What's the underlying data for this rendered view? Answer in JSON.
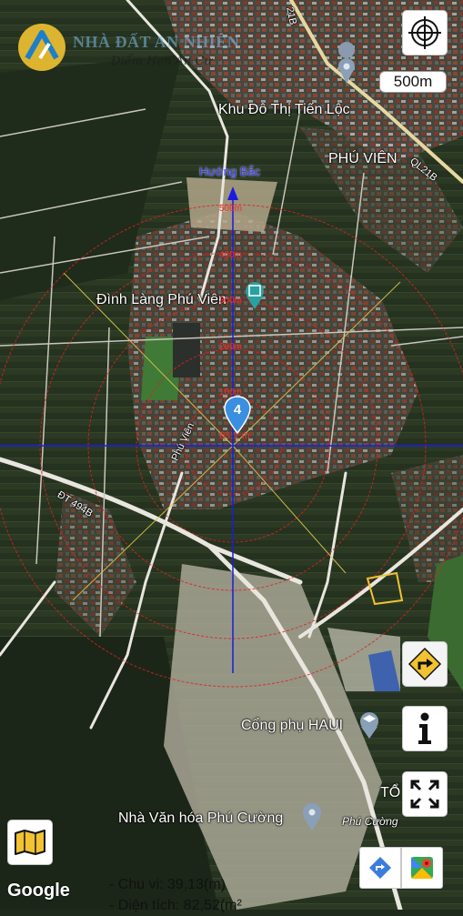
{
  "brand": {
    "name": "NHÀ ĐẤT AN NHIÊN",
    "slogan": "Điểm Hẹn An Cư"
  },
  "scale_label": "500m",
  "direction_label": "Hướng Bắc",
  "distance_rings": [
    "500m",
    "400m",
    "300m",
    "200m",
    "100m",
    "63.1 m"
  ],
  "places": {
    "tien_loc": "Khu Đô Thị Tiến Lộc",
    "phu_vien": "PHÚ VIÊN",
    "dinh_lang": "Đình Làng Phú Viên",
    "cong_phu": "Cổng phụ HAUI",
    "nha_van_hoa": "Nhà Văn hóa Phú Cường",
    "phu_cuong": "Phú Cường",
    "to": "TỔ"
  },
  "roads": {
    "ql21b_top": "21B",
    "ql21b_right": "QL21B",
    "phu_vien_road": "Phú Viên",
    "dt494b": "ĐT 494B"
  },
  "marker_number": "4",
  "measurement": {
    "perimeter": "- Chu vi: 39,13(m)",
    "area": "- Diện tích: 82,52(m²"
  },
  "attribution": "Google",
  "icons": {
    "target": "crosshair-target-icon",
    "directions": "turn-right-directions-icon",
    "info": "info-icon",
    "fullscreen": "fullscreen-icon",
    "layers": "map-layers-icon",
    "maps": "google-maps-icon",
    "nav": "navigation-diamond-icon"
  },
  "colors": {
    "crosshair": "#1a1ae6",
    "rings": "#e02020",
    "sector_line": "#d6c84a",
    "marker": "#3b8fe0",
    "accent_yellow": "#f1c232"
  }
}
